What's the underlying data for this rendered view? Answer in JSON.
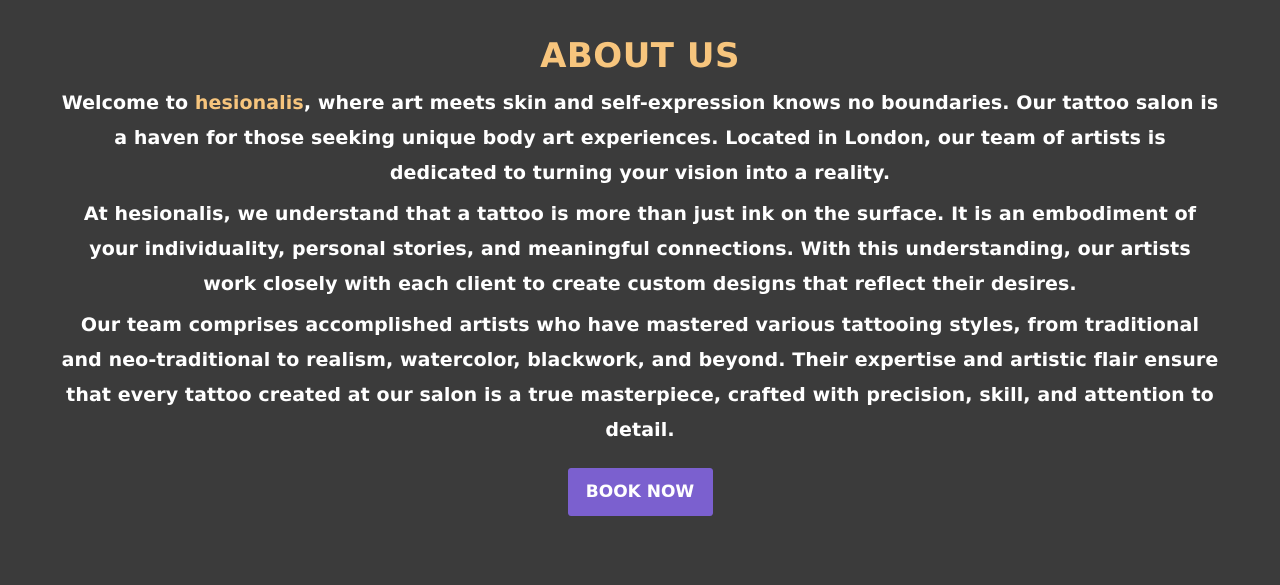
{
  "about": {
    "title": "ABOUT US",
    "p1": {
      "before": "Welcome to ",
      "brand": "hesionalis",
      "after": ", where art meets skin and self-expression knows no boundaries. Our tattoo salon is a haven for those seeking unique body art experiences. Located in London, our team of artists is dedicated to turning your vision into a reality."
    },
    "p2": "At hesionalis, we understand that a tattoo is more than just ink on the surface. It is an embodiment of your individuality, personal stories, and meaningful connections. With this understanding, our artists work closely with each client to create custom designs that reflect their desires.",
    "p3": "Our team comprises accomplished artists who have mastered various tattooing styles, from traditional and neo-traditional to realism, watercolor, blackwork, and beyond. Their expertise and artistic flair ensure that every tattoo created at our salon is a true masterpiece, crafted with precision, skill, and attention to detail.",
    "button": "BOOK NOW"
  },
  "colors": {
    "background": "#3b3b3b",
    "accent": "#f7c57d",
    "button": "#7b60cf",
    "text": "#ffffff"
  }
}
